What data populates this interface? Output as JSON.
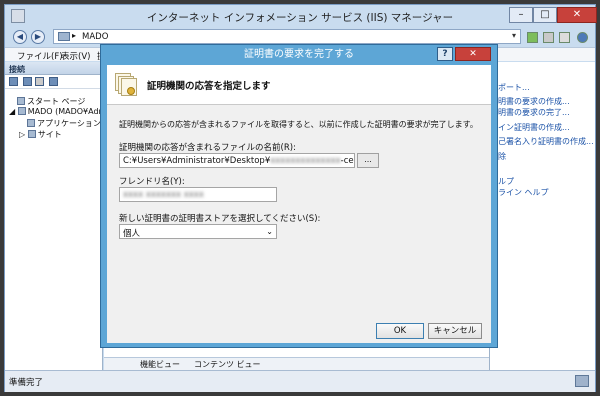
{
  "window": {
    "title": "インターネット インフォメーション サービス (IIS) マネージャー",
    "controls": {
      "minimize": "–",
      "maximize": "□",
      "close": "✕"
    }
  },
  "address": {
    "path": "MADO",
    "separator": "▸",
    "dropdown": "▾"
  },
  "menu": {
    "file": "ファイル(F)",
    "view": "表示(V)",
    "action": "操"
  },
  "connections": {
    "header": "接続",
    "tree": [
      {
        "label": "スタート ページ"
      },
      {
        "label": "MADO (MADO¥Adm"
      },
      {
        "label": "アプリケーション プー"
      },
      {
        "label": "サイト"
      }
    ]
  },
  "actions": {
    "items": [
      "ポート...",
      "明書の要求の作成...",
      "明書の要求の完了...",
      "イン証明書の作成...",
      "己署名入り証明書の作成...",
      "除",
      "ルプ",
      "ライン ヘルプ"
    ]
  },
  "viewtabs": {
    "features": "機能ビュー",
    "content": "コンテンツ ビュー"
  },
  "status": {
    "text": "準備完了"
  },
  "dialog": {
    "title": "証明書の要求を完了する",
    "help": "?",
    "close": "✕",
    "heading": "証明機関の応答を指定します",
    "description": "証明機関からの応答が含まれるファイルを取得すると、以前に作成した証明書の要求が完了します。",
    "file_label": "証明機関の応答が含まれるファイルの名前(R):",
    "file_value_prefix": "C:¥Users¥Administrator¥Desktop¥",
    "file_value_blurred": "xxxxxxxxxxxxxx",
    "file_value_suffix": "-cert.cer",
    "browse": "...",
    "friendly_label": "フレンドリ名(Y):",
    "friendly_value_blurred": "xxxx xxxxxxx xxxx",
    "store_label": "新しい証明書の証明書ストアを選択してください(S):",
    "store_value": "個人",
    "ok": "OK",
    "cancel": "キャンセル"
  }
}
